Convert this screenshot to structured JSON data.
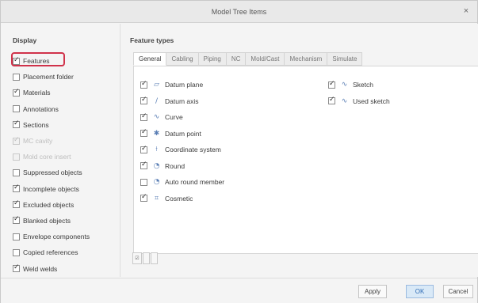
{
  "dialog": {
    "title": "Model Tree Items",
    "close_glyph": "×"
  },
  "left_panel": {
    "title": "Display",
    "items": [
      {
        "label": "Features",
        "checked": true,
        "disabled": false,
        "highlighted": true
      },
      {
        "label": "Placement folder",
        "checked": false,
        "disabled": false
      },
      {
        "label": "Materials",
        "checked": true,
        "disabled": false
      },
      {
        "label": "Annotations",
        "checked": false,
        "disabled": false
      },
      {
        "label": "Sections",
        "checked": true,
        "disabled": false
      },
      {
        "label": "MC cavity",
        "checked": true,
        "disabled": true
      },
      {
        "label": "Mold core insert",
        "checked": false,
        "disabled": true
      },
      {
        "label": "Suppressed objects",
        "checked": false,
        "disabled": false
      },
      {
        "label": "Incomplete objects",
        "checked": true,
        "disabled": false
      },
      {
        "label": "Excluded objects",
        "checked": true,
        "disabled": false
      },
      {
        "label": "Blanked objects",
        "checked": true,
        "disabled": false
      },
      {
        "label": "Envelope components",
        "checked": false,
        "disabled": false
      },
      {
        "label": "Copied references",
        "checked": false,
        "disabled": false
      },
      {
        "label": "Weld welds",
        "checked": true,
        "disabled": false
      }
    ]
  },
  "right_panel": {
    "title": "Feature types",
    "tabs": [
      {
        "label": "General",
        "active": true
      },
      {
        "label": "Cabling",
        "active": false
      },
      {
        "label": "Piping",
        "active": false
      },
      {
        "label": "NC",
        "active": false
      },
      {
        "label": "Mold/Cast",
        "active": false
      },
      {
        "label": "Mechanism",
        "active": false
      },
      {
        "label": "Simulate",
        "active": false
      }
    ],
    "features_left": [
      {
        "label": "Datum plane",
        "checked": true,
        "icon": "datum-plane-icon",
        "glyph": "▱"
      },
      {
        "label": "Datum axis",
        "checked": true,
        "icon": "datum-axis-icon",
        "glyph": "/"
      },
      {
        "label": "Curve",
        "checked": true,
        "icon": "curve-icon",
        "glyph": "∿"
      },
      {
        "label": "Datum point",
        "checked": true,
        "icon": "datum-point-icon",
        "glyph": "✱"
      },
      {
        "label": "Coordinate system",
        "checked": true,
        "icon": "coordinate-system-icon",
        "glyph": "⟊"
      },
      {
        "label": "Round",
        "checked": true,
        "icon": "round-icon",
        "glyph": "◔"
      },
      {
        "label": "Auto round member",
        "checked": false,
        "icon": "auto-round-icon",
        "glyph": "◔"
      },
      {
        "label": "Cosmetic",
        "checked": true,
        "icon": "cosmetic-icon",
        "glyph": "⌗"
      }
    ],
    "features_right": [
      {
        "label": "Sketch",
        "checked": true,
        "icon": "sketch-icon",
        "glyph": "∿"
      },
      {
        "label": "Used sketch",
        "checked": true,
        "icon": "used-sketch-icon",
        "glyph": "∿"
      }
    ],
    "tools": [
      {
        "name": "select-all-button",
        "glyph": "☑"
      },
      {
        "name": "deselect-all-button",
        "glyph": ""
      },
      {
        "name": "invert-selection-button",
        "glyph": ""
      }
    ]
  },
  "footer": {
    "apply_label": "Apply",
    "ok_label": "OK",
    "cancel_label": "Cancel"
  },
  "colors": {
    "highlight": "#d0324a",
    "ok_bg": "#d9e9f7",
    "icon_blue": "#5b7fb5"
  }
}
